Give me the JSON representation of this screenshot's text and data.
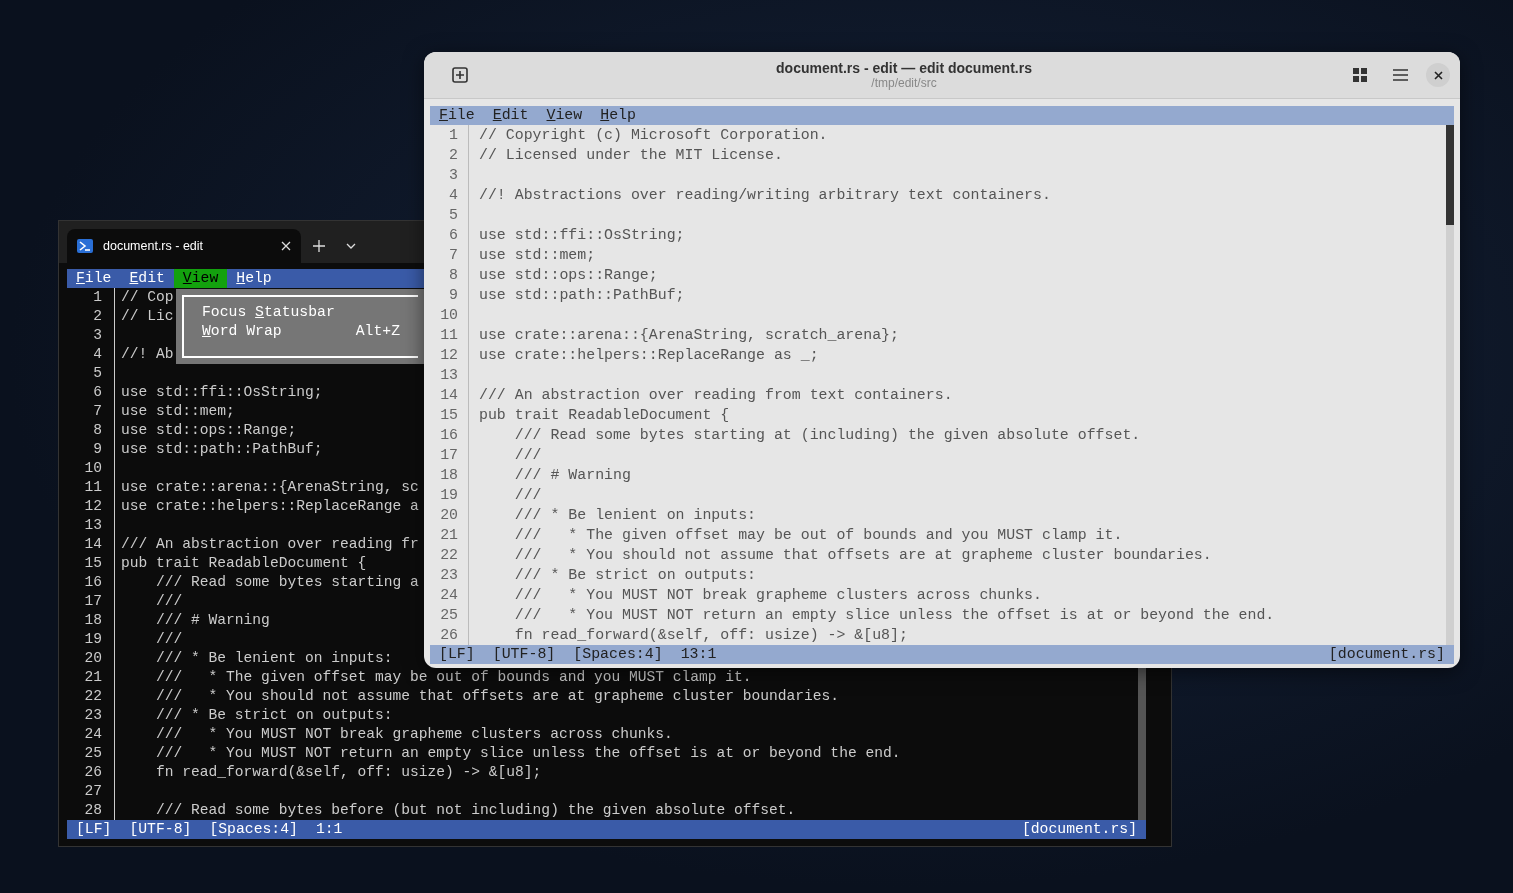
{
  "terminal_window": {
    "tab": {
      "title": "document.rs - edit"
    },
    "menu": [
      {
        "key": "F",
        "post": "ile",
        "selected": false
      },
      {
        "key": "E",
        "post": "dit",
        "selected": false
      },
      {
        "key": "V",
        "post": "iew",
        "selected": true
      },
      {
        "key": "H",
        "post": "elp",
        "selected": false
      }
    ],
    "dropdown": {
      "items": [
        {
          "pre": "Focus ",
          "key": "S",
          "post": "tatusbar"
        },
        {
          "key": "W",
          "post": "ord Wrap",
          "shortcut": "Alt+Z"
        }
      ]
    },
    "lines": [
      {
        "number": "1",
        "text": "// Cop"
      },
      {
        "number": "2",
        "text": "// Lic"
      },
      {
        "number": "3"
      },
      {
        "number": "4",
        "text": "//! Ab"
      },
      {
        "number": "5"
      },
      {
        "number": "6",
        "text": "use std::ffi::OsString;"
      },
      {
        "number": "7",
        "text": "use std::mem;"
      },
      {
        "number": "8",
        "text": "use std::ops::Range;"
      },
      {
        "number": "9",
        "text": "use std::path::PathBuf;"
      },
      {
        "number": "10"
      },
      {
        "number": "11",
        "text": "use crate::arena::{ArenaString, sc"
      },
      {
        "number": "12",
        "text": "use crate::helpers::ReplaceRange a"
      },
      {
        "number": "13"
      },
      {
        "number": "14",
        "text": "/// An abstraction over reading fr"
      },
      {
        "number": "15",
        "text": "pub trait ReadableDocument {"
      },
      {
        "number": "16",
        "text": "    /// Read some bytes starting a"
      },
      {
        "number": "17",
        "text": "    ///"
      },
      {
        "number": "18",
        "text": "    /// # Warning"
      },
      {
        "number": "19",
        "text": "    ///"
      },
      {
        "number": "20",
        "text": "    /// * Be lenient on inputs:"
      },
      {
        "number": "21",
        "text": "    ///   * The given offset may be out of bounds and you MUST clamp it."
      },
      {
        "number": "22",
        "text": "    ///   * You should not assume that offsets are at grapheme cluster boundaries."
      },
      {
        "number": "23",
        "text": "    /// * Be strict on outputs:"
      },
      {
        "number": "24",
        "text": "    ///   * You MUST NOT break grapheme clusters across chunks."
      },
      {
        "number": "25",
        "text": "    ///   * You MUST NOT return an empty slice unless the offset is at or beyond the end."
      },
      {
        "number": "26",
        "text": "    fn read_forward(&self, off: usize) -> &[u8];"
      },
      {
        "number": "27"
      },
      {
        "number": "28",
        "text": "    /// Read some bytes before (but not including) the given absolute offset."
      }
    ],
    "status_bar": {
      "items": [
        "[LF]",
        "[UTF-8]",
        "[Spaces:4]",
        "1:1"
      ],
      "file": "[document.rs]"
    }
  },
  "editor_window": {
    "title": "document.rs - edit — edit document.rs",
    "subtitle": "/tmp/edit/src",
    "menu": [
      {
        "key": "F",
        "post": "ile",
        "selected": false
      },
      {
        "key": "E",
        "post": "dit",
        "selected": false
      },
      {
        "key": "V",
        "post": "iew",
        "selected": false
      },
      {
        "key": "H",
        "post": "elp",
        "selected": false
      }
    ],
    "lines": [
      {
        "number": "1",
        "text": "// Copyright (c) Microsoft Corporation."
      },
      {
        "number": "2",
        "text": "// Licensed under the MIT License."
      },
      {
        "number": "3"
      },
      {
        "number": "4",
        "text": "//! Abstractions over reading/writing arbitrary text containers."
      },
      {
        "number": "5"
      },
      {
        "number": "6",
        "text": "use std::ffi::OsString;"
      },
      {
        "number": "7",
        "text": "use std::mem;"
      },
      {
        "number": "8",
        "text": "use std::ops::Range;"
      },
      {
        "number": "9",
        "text": "use std::path::PathBuf;"
      },
      {
        "number": "10"
      },
      {
        "number": "11",
        "text": "use crate::arena::{ArenaString, scratch_arena};"
      },
      {
        "number": "12",
        "text": "use crate::helpers::ReplaceRange as _;"
      },
      {
        "number": "13"
      },
      {
        "number": "14",
        "text": "/// An abstraction over reading from text containers."
      },
      {
        "number": "15",
        "text": "pub trait ReadableDocument {"
      },
      {
        "number": "16",
        "text": "    /// Read some bytes starting at (including) the given absolute offset."
      },
      {
        "number": "17",
        "text": "    ///"
      },
      {
        "number": "18",
        "text": "    /// # Warning"
      },
      {
        "number": "19",
        "text": "    ///"
      },
      {
        "number": "20",
        "text": "    /// * Be lenient on inputs:"
      },
      {
        "number": "21",
        "text": "    ///   * The given offset may be out of bounds and you MUST clamp it."
      },
      {
        "number": "22",
        "text": "    ///   * You should not assume that offsets are at grapheme cluster boundaries."
      },
      {
        "number": "23",
        "text": "    /// * Be strict on outputs:"
      },
      {
        "number": "24",
        "text": "    ///   * You MUST NOT break grapheme clusters across chunks."
      },
      {
        "number": "25",
        "text": "    ///   * You MUST NOT return an empty slice unless the offset is at or beyond the end."
      },
      {
        "number": "26",
        "text": "    fn read_forward(&self, off: usize) -> &[u8];"
      }
    ],
    "status_bar": {
      "items": [
        "[LF]",
        "[UTF-8]",
        "[Spaces:4]",
        "13:1"
      ],
      "file": "[document.rs]"
    }
  }
}
